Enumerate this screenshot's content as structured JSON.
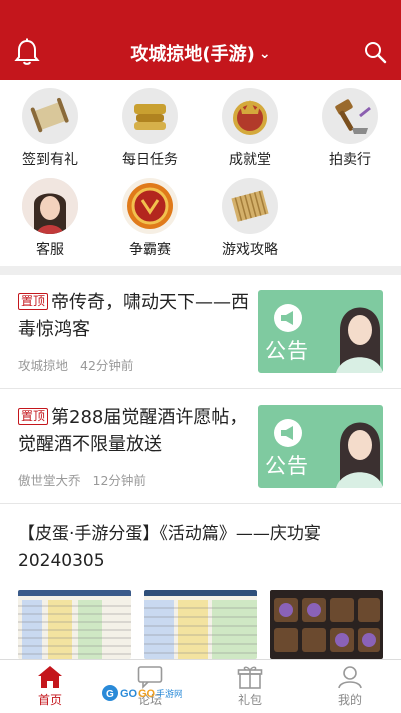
{
  "header": {
    "title": "攻城掠地(手游)",
    "title_chevron_icon": "chevron-down-icon",
    "left_icon": "bell-icon",
    "right_icon": "search-icon",
    "color": "#c4161c"
  },
  "quick": [
    {
      "label": "签到有礼",
      "icon": "signin-scroll-icon"
    },
    {
      "label": "每日任务",
      "icon": "daily-task-icon"
    },
    {
      "label": "成就堂",
      "icon": "achievement-icon"
    },
    {
      "label": "拍卖行",
      "icon": "auction-hammer-icon"
    },
    {
      "label": "客服",
      "icon": "customer-service-icon"
    },
    {
      "label": "争霸赛",
      "icon": "tournament-icon"
    },
    {
      "label": "游戏攻略",
      "icon": "guide-scroll-icon"
    }
  ],
  "news": [
    {
      "badge": "置顶",
      "title": "帝传奇，啸动天下——西毒惊鸿客",
      "author": "攻城掠地",
      "time": "42分钟前",
      "image_text": "公告"
    },
    {
      "badge": "置顶",
      "title": "第288届觉醒酒许愿帖，觉醒酒不限量放送",
      "author": "傲世堂大乔",
      "time": "12分钟前",
      "image_text": "公告"
    }
  ],
  "post": {
    "title": "【皮蛋·手游分蛋】《活动篇》——庆功宴20240305"
  },
  "nav": [
    {
      "label": "首页",
      "icon": "home-icon",
      "active": true
    },
    {
      "label": "论坛",
      "icon": "chat-icon",
      "active": false
    },
    {
      "label": "礼包",
      "icon": "gift-icon",
      "active": false
    },
    {
      "label": "我的",
      "icon": "user-icon",
      "active": false
    }
  ],
  "watermark": "GOGO手游网"
}
